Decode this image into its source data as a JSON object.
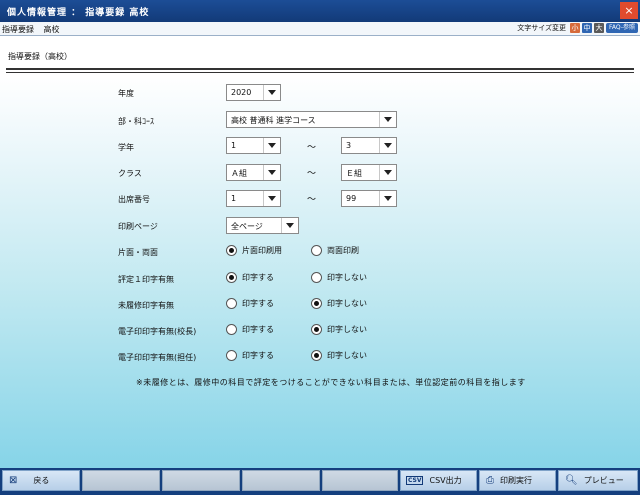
{
  "window": {
    "title": "個人情報管理 ： 指導要録 高校",
    "close_label": "×"
  },
  "menubar": {
    "crumbs": [
      "指導要録",
      "高校"
    ],
    "fontsize_label": "文字サイズ変更",
    "fontsize_buttons": [
      "小",
      "中",
      "大"
    ],
    "faq_label": "FAQ-参照"
  },
  "main": {
    "section_title": "指導要録（高校）",
    "tilde": "～",
    "rows": {
      "year": {
        "label": "年度",
        "value": "2020"
      },
      "course": {
        "label": "部・科ｺｰｽ",
        "value": "高校 普通科 進学コース"
      },
      "grade": {
        "label": "学年",
        "from": "1",
        "to": "3"
      },
      "class": {
        "label": "クラス",
        "from": "Ａ組",
        "to": "Ｅ組"
      },
      "seat": {
        "label": "出席番号",
        "from": "1",
        "to": "99"
      },
      "page": {
        "label": "印刷ページ",
        "value": "全ページ"
      },
      "side": {
        "label": "片面・両面",
        "opt1": "片面印刷用",
        "opt2": "両面印刷",
        "selected": 1
      },
      "hyotei": {
        "label": "評定１印字有無",
        "opt1": "印字する",
        "opt2": "印字しない",
        "selected": 1
      },
      "mirishu": {
        "label": "未履修印字有無",
        "opt1": "印字する",
        "opt2": "印字しない",
        "selected": 2
      },
      "seal_principal": {
        "label": "電子印印字有無(校長)",
        "opt1": "印字する",
        "opt2": "印字しない",
        "selected": 2
      },
      "seal_teacher": {
        "label": "電子印印字有無(担任)",
        "opt1": "印字する",
        "opt2": "印字しない",
        "selected": 2
      }
    },
    "note": "※未履修とは、履修中の科目で評定をつけることができない科目または、単位認定前の科目を指します"
  },
  "footer": {
    "back_label": "戻る",
    "csv_label": "CSV出力",
    "print_label": "印刷実行",
    "preview_label": "プレビュー"
  },
  "icons": {
    "back": "back-icon",
    "csv": "csv-icon",
    "print": "printer-icon",
    "preview": "magnifier-icon"
  }
}
